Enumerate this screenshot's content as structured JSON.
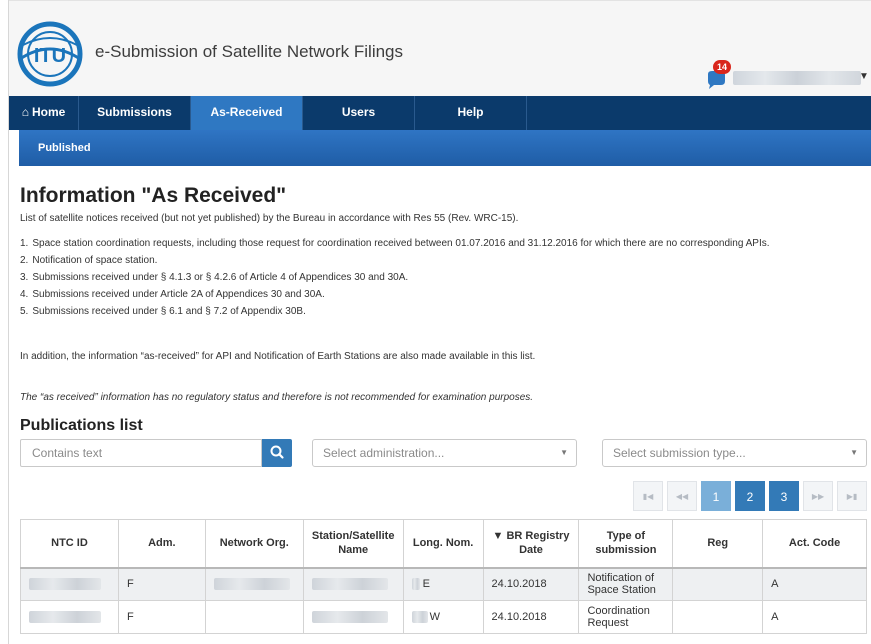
{
  "header": {
    "app_title": "e-Submission of Satellite Network Filings",
    "notification_count": "14",
    "logo_text": "ITU",
    "accent_color": "#0b3a6b"
  },
  "nav": {
    "home": "Home",
    "submissions": "Submissions",
    "as_received": "As-Received",
    "users": "Users",
    "help": "Help",
    "active": "As-Received"
  },
  "subnav": {
    "published": "Published"
  },
  "page": {
    "title": "Information \"As Received\"",
    "intro": "List of satellite notices received (but not yet published) by the Bureau in accordance with Res 55 (Rev. WRC-15).",
    "items": [
      "Space station coordination requests, including those request for coordination received between 01.07.2016 and 31.12.2016 for which there are no corresponding APIs.",
      "Notification of space station.",
      "Submissions received under § 4.1.3 or § 4.2.6 of Article 4 of Appendices 30 and 30A.",
      "Submissions received under Article 2A of Appendices 30 and 30A.",
      "Submissions received under § 6.1 and § 7.2 of Appendix 30B."
    ],
    "note": "In addition, the information “as-received” for API and Notification of Earth Stations are also made available in this list.",
    "italic_note": "The “as received” information has no regulatory status and therefore is not recommended for examination purposes.",
    "section_title": "Publications list"
  },
  "filters": {
    "search_placeholder": "Contains text",
    "admin_placeholder": "Select administration...",
    "type_placeholder": "Select submission type..."
  },
  "pager": {
    "first": "⏮",
    "prev": "⏪",
    "pages": [
      "1",
      "2",
      "3"
    ],
    "current": "1",
    "next": "⏩",
    "last": "⏭"
  },
  "table": {
    "columns": [
      "NTC ID",
      "Adm.",
      "Network Org.",
      "Station/Satellite Name",
      "Long. Nom.",
      "▼ BR Registry Date",
      "Type of submission",
      "Reg",
      "Act. Code"
    ],
    "rows": [
      {
        "adm": "F",
        "long_suffix": "E",
        "date": "24.10.2018",
        "type": "Notification of Space Station",
        "reg": "",
        "act": "A"
      },
      {
        "adm": "F",
        "long_suffix": "W",
        "date": "24.10.2018",
        "type": "Coordination Request",
        "reg": "",
        "act": "A"
      }
    ]
  }
}
